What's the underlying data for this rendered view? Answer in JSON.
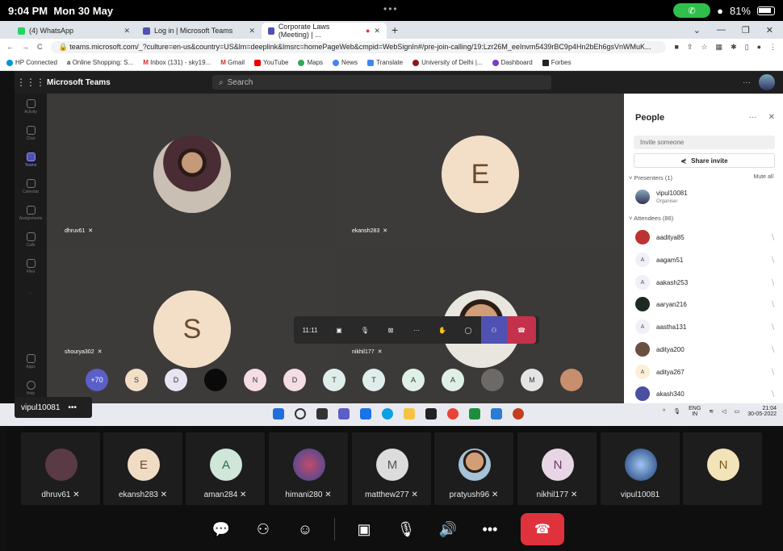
{
  "status": {
    "time": "9:04 PM",
    "date": "Mon 30 May",
    "center": "•••",
    "battery": "81%"
  },
  "tabs": [
    {
      "label": "(4) WhatsApp",
      "color": "#25d366"
    },
    {
      "label": "Log in | Microsoft Teams",
      "color": "#4f52b2"
    },
    {
      "label": "Corporate Laws (Meeting) | ...",
      "color": "#4f52b2"
    }
  ],
  "address": {
    "url": "teams.microsoft.com/_?culture=en-us&country=US&lm=deeplink&lmsrc=homePageWeb&cmpid=WebSignIn#/pre-join-calling/19:Lzr26M_eeInvm5439rBC9p4Hn2bEh6gsVnWMuK..."
  },
  "bookmarks": [
    "HP Connected",
    "Online Shopping: S...",
    "Inbox (131) - sky19...",
    "Gmail",
    "YouTube",
    "Maps",
    "News",
    "Translate",
    "University of Delhi |...",
    "Dashboard",
    "Forbes"
  ],
  "teams": {
    "brand": "Microsoft Teams",
    "search_placeholder": "Search"
  },
  "rail": [
    "Activity",
    "Chat",
    "Teams",
    "Calendar",
    "Assignments",
    "Calls",
    "Files"
  ],
  "rail_bottom": [
    "Apps",
    "Help"
  ],
  "stage": {
    "tiles": [
      {
        "name": "dhruv61"
      },
      {
        "name": "ekansh283",
        "initial": "E"
      },
      {
        "name": "shourya302",
        "initial": "S"
      },
      {
        "name": "nikhil177"
      }
    ],
    "call_time": "11:11",
    "more_count": "+70",
    "strip_initials": [
      "S",
      "D",
      "",
      "N",
      "D",
      "T",
      "T",
      "A",
      "A",
      "",
      "M",
      ""
    ]
  },
  "people": {
    "title": "People",
    "invite_placeholder": "Invite someone",
    "share_label": "Share invite",
    "presenters_label": "Presenters (1)",
    "mute_all": "Mute all",
    "presenter": {
      "name": "vipul10081",
      "role": "Organiser"
    },
    "attendees_label": "Attendees (86)",
    "attendees": [
      {
        "name": "aaditya85",
        "initial": ""
      },
      {
        "name": "aagam51",
        "initial": "A"
      },
      {
        "name": "aakash253",
        "initial": "A"
      },
      {
        "name": "aaryan216",
        "initial": ""
      },
      {
        "name": "aastha131",
        "initial": "A"
      },
      {
        "name": "aditya200",
        "initial": ""
      },
      {
        "name": "aditya267",
        "initial": "A"
      },
      {
        "name": "akash340",
        "initial": ""
      }
    ]
  },
  "presenter_bar": {
    "name": "vipul10081",
    "menu": "•••"
  },
  "tray": {
    "lang": "ENG",
    "region": "IN",
    "time": "21:04",
    "date": "30-05-2022"
  },
  "participants": [
    {
      "name": "dhruv61",
      "initial": "",
      "bg": "#5a3a44"
    },
    {
      "name": "ekansh283",
      "initial": "E",
      "bg": "#f0dcc5"
    },
    {
      "name": "aman284",
      "initial": "A",
      "bg": "#cfe6d9"
    },
    {
      "name": "himani280",
      "initial": "",
      "bg": "#7a4c7a"
    },
    {
      "name": "matthew277",
      "initial": "M",
      "bg": "#dcdcdc"
    },
    {
      "name": "pratyush96",
      "initial": "",
      "bg": "#a5c2d6"
    },
    {
      "name": "nikhil177",
      "initial": "N",
      "bg": "#e8d6e6"
    },
    {
      "name": "vipul10081",
      "initial": "",
      "bg": "#3d6fa8"
    },
    {
      "name": "",
      "initial": "N",
      "bg": "#f2e3b8"
    }
  ]
}
